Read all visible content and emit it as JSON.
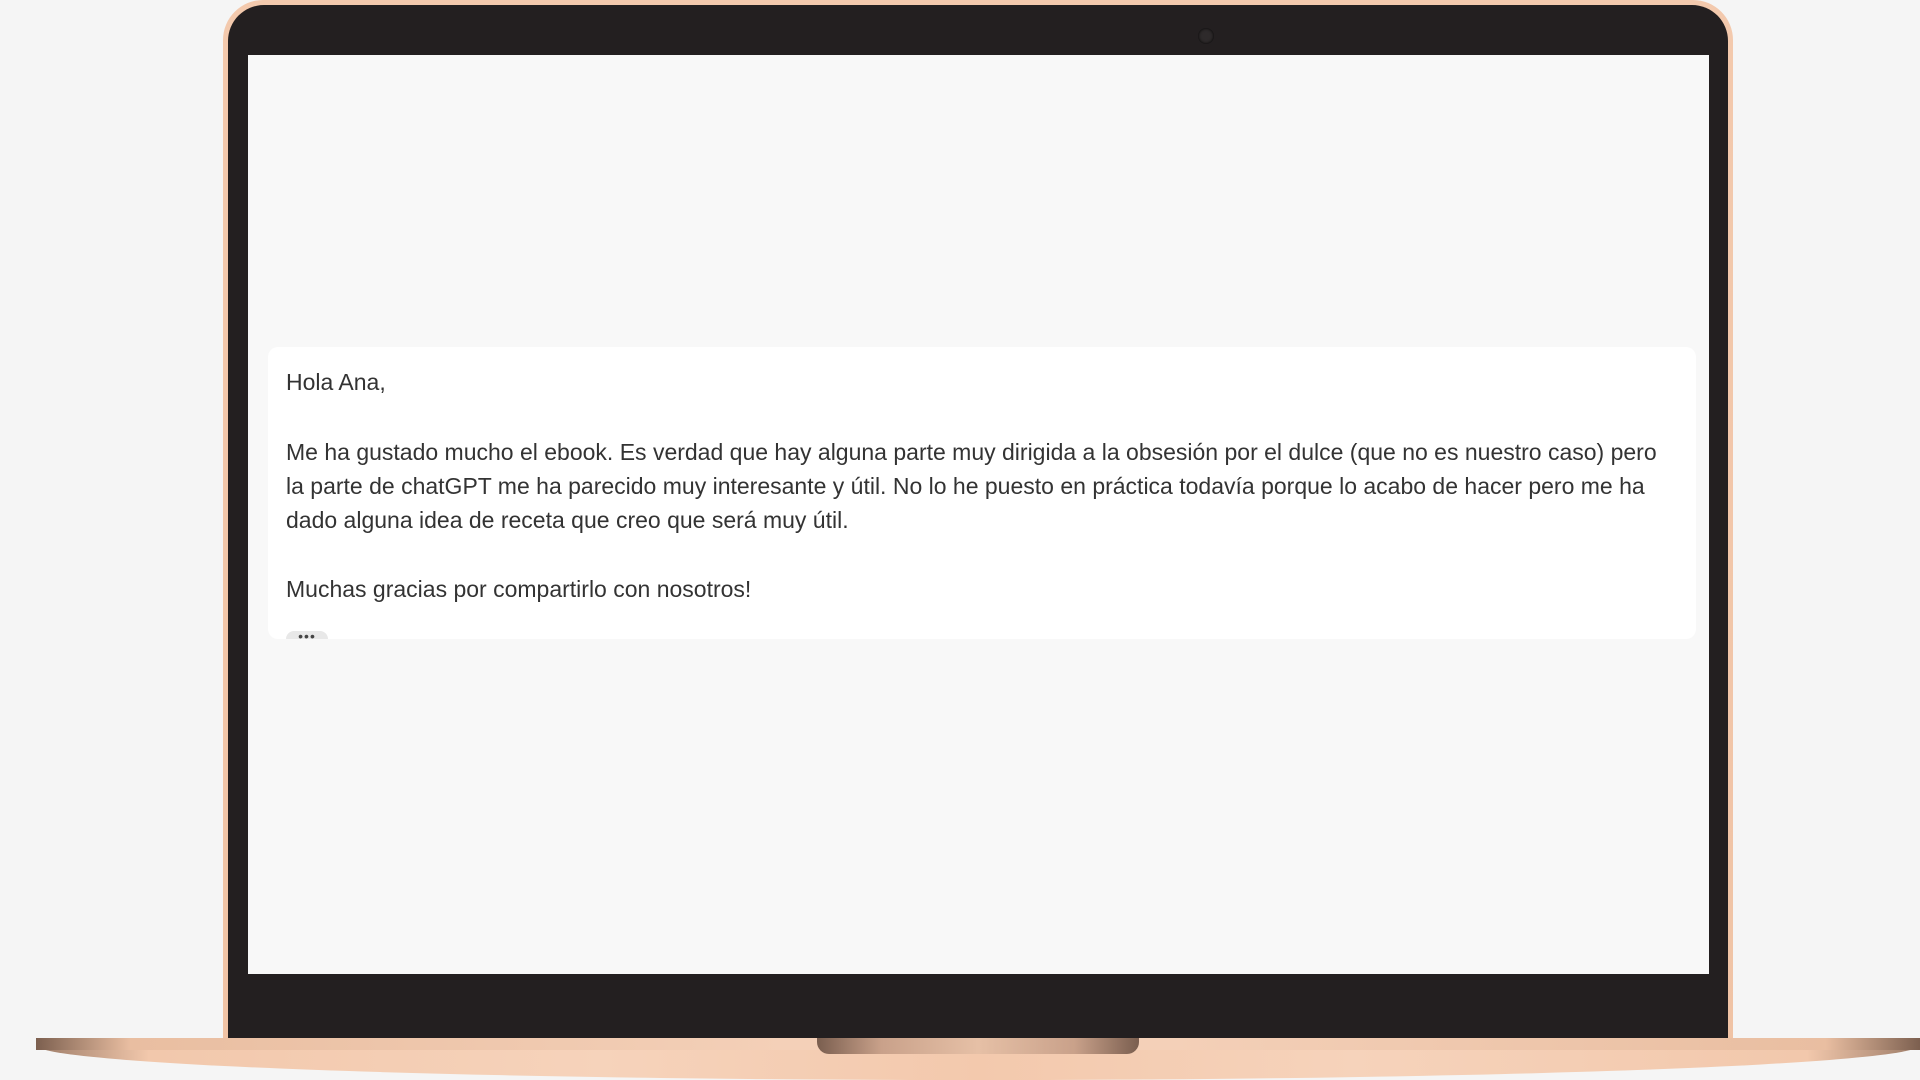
{
  "message": {
    "greeting": "Hola Ana,",
    "body": "Me ha gustado mucho el ebook. Es verdad que hay alguna parte muy dirigida a la obsesión por el dulce (que no es nuestro caso) pero la parte de chatGPT me ha parecido muy interesante y útil. No lo he puesto en práctica todavía porque lo acabo de hacer pero me ha dado alguna idea de receta que creo que será muy útil.",
    "closing": "Muchas gracias por compartirlo con nosotros!",
    "more_label": "•••"
  },
  "colors": {
    "bezel": "#231f20",
    "screen_bg": "#f8f8f8",
    "card_bg": "#ffffff",
    "text": "#333333",
    "rose_gold": "#f3c9ad"
  }
}
